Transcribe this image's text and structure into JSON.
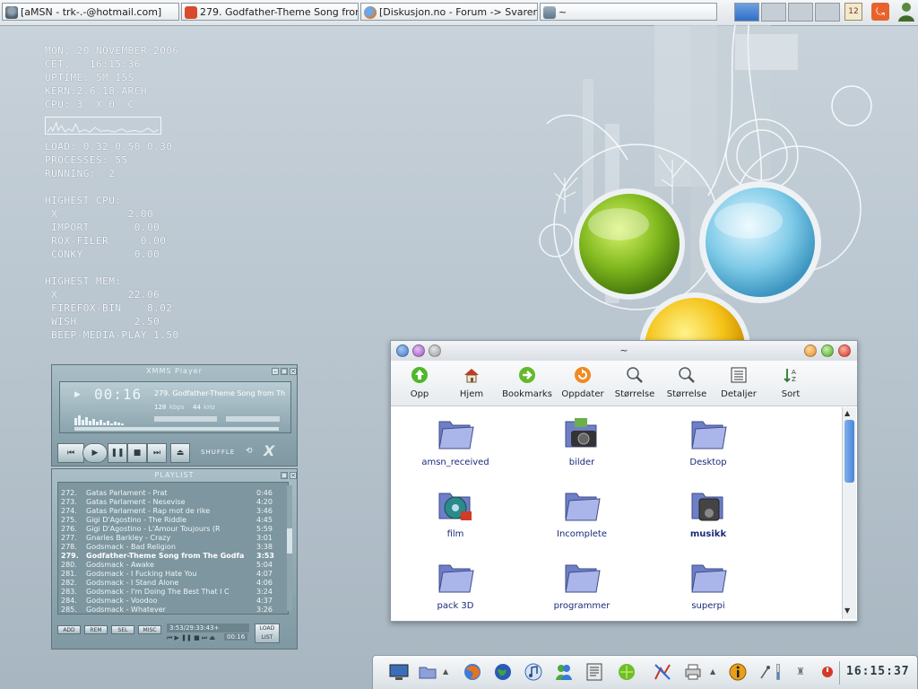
{
  "taskbar": {
    "tasks": [
      {
        "label": "[aMSN - trk-.-@hotmail.com]"
      },
      {
        "label": "279. Godfather-Theme Song from..."
      },
      {
        "label": "[Diskusjon.no - Forum -> Svarer i ..."
      },
      {
        "label": "~"
      }
    ],
    "calendar_day": "12"
  },
  "conky": {
    "lines": [
      "MON, 20 NOVEMBER 2006",
      "CET,   16:15:36",
      "UPTIME: 5M 15S",
      "KERN:2.6.18-ARCH",
      "CPU: 3  X 0  C",
      "LOAD: 0.32 0.50 0.30",
      "PROCESSES: 55",
      "RUNNING:  2",
      "HIGHEST CPU:",
      " X           2.00",
      " IMPORT       0.00",
      " ROX-FILER     0.00",
      " CONKY        0.00",
      "HIGHEST MEM:",
      " X           22.06",
      " FIREFOX-BIN    8.02",
      " WISH         2.50",
      " BEEP-MEDIA-PLAY 1.50"
    ]
  },
  "xmms": {
    "title": "XMMS Player",
    "time": "00:16",
    "song": "279. Godfather-Theme Song from Th",
    "kbps": "128",
    "kbps_unit": "kbps",
    "khz": "44",
    "khz_unit": "kHz",
    "shuffle": "SHUFFLE",
    "playlist_title": "PLAYLIST",
    "playlist": [
      {
        "n": "272.",
        "t": "Gatas Parlament - Prat",
        "d": "0:46"
      },
      {
        "n": "273.",
        "t": "Gatas Parlament - Nesevise",
        "d": "4:20"
      },
      {
        "n": "274.",
        "t": "Gatas Parlament - Rap mot de rike",
        "d": "3:46"
      },
      {
        "n": "275.",
        "t": "Gigi D'Agostino - The Riddle",
        "d": "4:45"
      },
      {
        "n": "276.",
        "t": "Gigi D'Agostino - L'Amour Toujours (R",
        "d": "5:59"
      },
      {
        "n": "277.",
        "t": "Gnarles Barkley - Crazy",
        "d": "3:01"
      },
      {
        "n": "278.",
        "t": "Godsmack - Bad Religion",
        "d": "3:38"
      },
      {
        "n": "279.",
        "t": "Godfather-Theme Song from The Godfa",
        "d": "3:53"
      },
      {
        "n": "280.",
        "t": "Godsmack - Awake",
        "d": "5:04"
      },
      {
        "n": "281.",
        "t": "Godsmack - I Fucking Hate You",
        "d": "4:07"
      },
      {
        "n": "282.",
        "t": "Godsmack - I Stand Alone",
        "d": "4:06"
      },
      {
        "n": "283.",
        "t": "Godsmack - I'm Doing The Best That I C",
        "d": "3:24"
      },
      {
        "n": "284.",
        "t": "Godsmack - Voodoo",
        "d": "4:37"
      },
      {
        "n": "285.",
        "t": "Godsmack - Whatever",
        "d": "3:26"
      }
    ],
    "pl_buttons": [
      "ADD",
      "REM",
      "SEL",
      "MISC"
    ],
    "pl_total": "3:53/29:33:43+",
    "pl_time": "00:16",
    "load_list": "LOAD LIST"
  },
  "filemanager": {
    "title": "~",
    "toolbar": [
      {
        "label": "Opp",
        "icon": "up-arrow-icon"
      },
      {
        "label": "Hjem",
        "icon": "home-icon"
      },
      {
        "label": "Bookmarks",
        "icon": "bookmarks-icon"
      },
      {
        "label": "Oppdater",
        "icon": "refresh-icon"
      },
      {
        "label": "Størrelse",
        "icon": "zoom-in-icon"
      },
      {
        "label": "Størrelse",
        "icon": "zoom-out-icon"
      },
      {
        "label": "Detaljer",
        "icon": "details-icon"
      },
      {
        "label": "Sort",
        "icon": "sort-icon"
      }
    ],
    "items": [
      {
        "label": "amsn_received",
        "icon": "folder-icon"
      },
      {
        "label": "bilder",
        "icon": "camera-folder-icon"
      },
      {
        "label": "Desktop",
        "icon": "folder-icon"
      },
      {
        "label": "film",
        "icon": "film-folder-icon"
      },
      {
        "label": "Incomplete",
        "icon": "folder-icon"
      },
      {
        "label": "musikk",
        "icon": "music-folder-icon"
      },
      {
        "label": "pack 3D",
        "icon": "folder-icon"
      },
      {
        "label": "programmer",
        "icon": "folder-icon"
      },
      {
        "label": "superpi",
        "icon": "folder-icon"
      }
    ]
  },
  "panel": {
    "clock": "16:15:37"
  }
}
